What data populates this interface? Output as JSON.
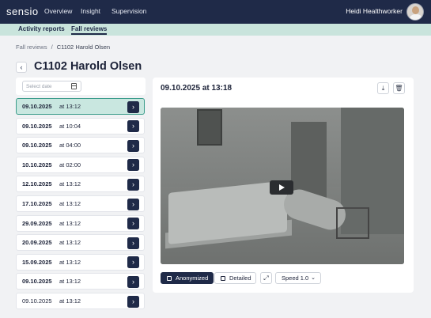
{
  "app": {
    "logo": "sensio",
    "nav": [
      "Overview",
      "Insight",
      "Supervision"
    ],
    "user_name": "Heidi Healthworker"
  },
  "subnav": {
    "tabs": [
      "Activity reports",
      "Fall reviews"
    ],
    "active": "Fall reviews"
  },
  "breadcrumb": {
    "parent": "Fall reviews",
    "separator": "/",
    "current": "C1102 Harold Olsen"
  },
  "page": {
    "title": "C1102 Harold Olsen",
    "back_icon": "chevron-left-icon"
  },
  "date_filter": {
    "placeholder": "Select date",
    "icon": "calendar-icon"
  },
  "events": [
    {
      "date": "09.10.2025",
      "time": "at 13:12",
      "selected": true,
      "bold": true
    },
    {
      "date": "09.10.2025",
      "time": "at 10:04",
      "selected": false,
      "bold": true
    },
    {
      "date": "09.10.2025",
      "time": "at 04:00",
      "selected": false,
      "bold": true
    },
    {
      "date": "10.10.2025",
      "time": "at 02:00",
      "selected": false,
      "bold": true
    },
    {
      "date": "12.10.2025",
      "time": "at 13:12",
      "selected": false,
      "bold": true
    },
    {
      "date": "17.10.2025",
      "time": "at 13:12",
      "selected": false,
      "bold": true
    },
    {
      "date": "29.09.2025",
      "time": "at 13:12",
      "selected": false,
      "bold": true
    },
    {
      "date": "20.09.2025",
      "time": "at 13:12",
      "selected": false,
      "bold": true
    },
    {
      "date": "15.09.2025",
      "time": "at 13:12",
      "selected": false,
      "bold": true
    },
    {
      "date": "09.10.2025",
      "time": "at 13:12",
      "selected": false,
      "bold": true
    },
    {
      "date": "09.10.2025",
      "time": "at 13:12",
      "selected": false,
      "bold": false
    }
  ],
  "detail": {
    "title": "09.10.2025 at 13:18",
    "download_icon": "download-icon",
    "delete_icon": "trash-icon",
    "play_icon": "play-icon"
  },
  "controls": {
    "anonymized_label": "Anonymized",
    "detailed_label": "Detailed",
    "expand_icon": "expand-icon",
    "speed_label": "Speed 1.0",
    "accent": "#1f2a48"
  },
  "colors": {
    "nav_bg": "#1f2a48",
    "subnav_bg": "#c9e4dc",
    "selected_bg": "#c9e7e0",
    "selected_border": "#3a9c8a"
  }
}
